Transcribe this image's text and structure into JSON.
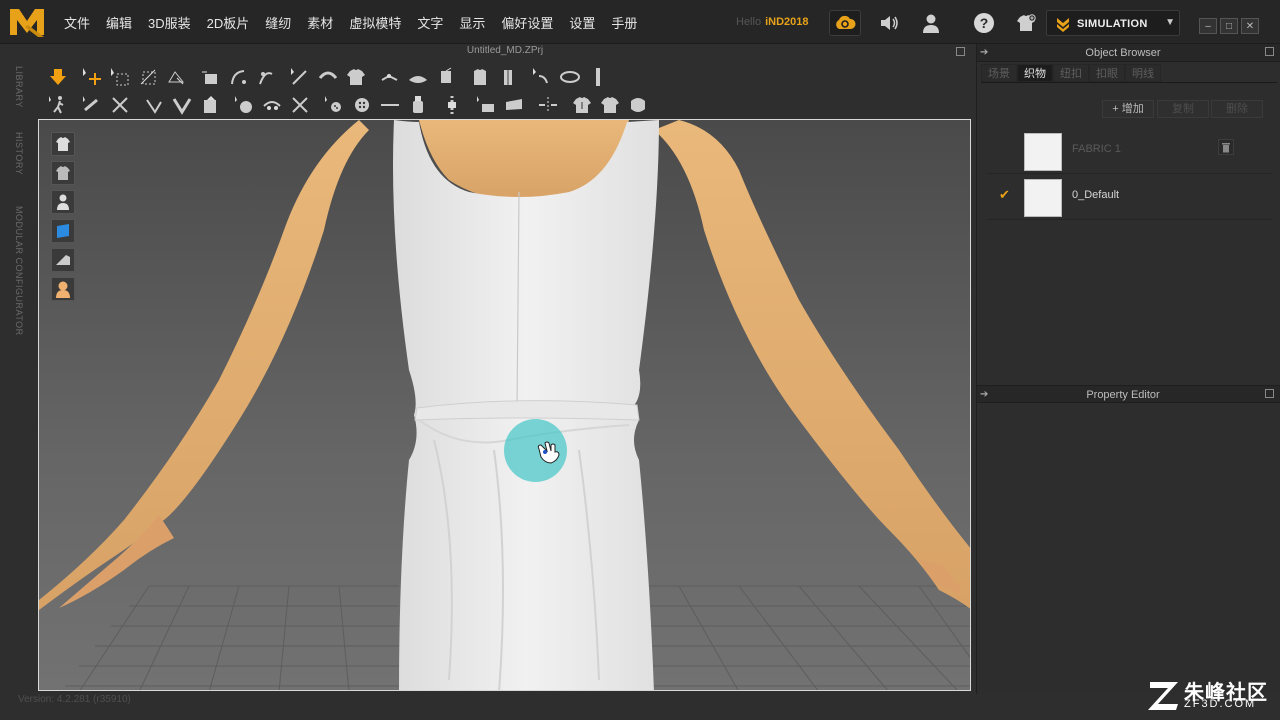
{
  "app": {
    "menu": [
      "文件",
      "编辑",
      "3D服装",
      "2D板片",
      "缝纫",
      "素材",
      "虚拟模特",
      "文字",
      "显示",
      "偏好设置",
      "设置",
      "手册"
    ],
    "hello_label": "Hello",
    "user_name": "iND2018",
    "mode_label": "SIMULATION",
    "accent": "#e8a21a"
  },
  "left_rail": {
    "tabs": [
      "LIBRARY",
      "HISTORY",
      "MODULAR CONFIGURATOR"
    ]
  },
  "viewport": {
    "doc_title": "Untitled_MD.ZPrj"
  },
  "object_browser": {
    "title": "Object Browser",
    "tabs": [
      "场景",
      "织物",
      "纽扣",
      "扣眼",
      "明线"
    ],
    "active_tab": "织物",
    "actions": {
      "add": "+ 增加",
      "copy": "复制",
      "delete": "删除"
    },
    "fabrics": [
      {
        "name": "FABRIC 1",
        "selected": false
      },
      {
        "name": "0_Default",
        "selected": true
      }
    ]
  },
  "property_editor": {
    "title": "Property Editor"
  },
  "status": {
    "version": "Version: 4.2.281 (r35910)"
  },
  "watermark": {
    "text": "朱峰社区",
    "sub": "ZF3D.COM"
  }
}
